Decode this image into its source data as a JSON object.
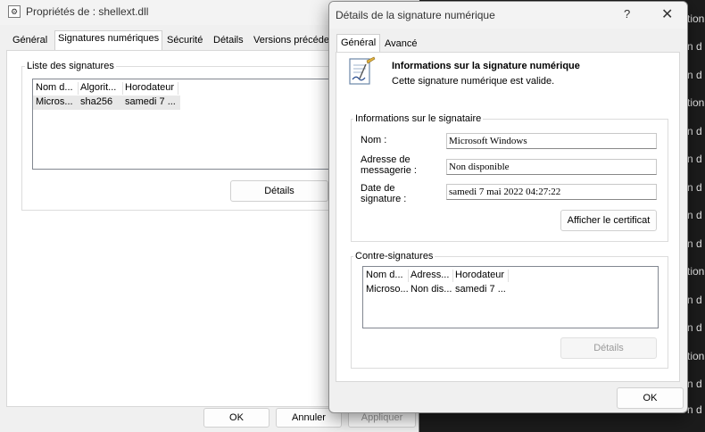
{
  "background_text": [
    "tion",
    "n d",
    "n d",
    "tion",
    "n d",
    "n d",
    "n d",
    "n d",
    "n d",
    "tion",
    "n d",
    "n d",
    "tion",
    "n d",
    "n d"
  ],
  "properties_window": {
    "title": "Propriétés de : shellext.dll",
    "tabs": [
      "Général",
      "Signatures numériques",
      "Sécurité",
      "Détails",
      "Versions précéde"
    ],
    "active_tab": "Signatures numériques",
    "group_label": "Liste des signatures",
    "columns": [
      "Nom d...",
      "Algorit...",
      "Horodateur"
    ],
    "rows": [
      [
        "Micros...",
        "sha256",
        "samedi 7 ..."
      ]
    ],
    "details_label": "Détails",
    "ok_label": "OK",
    "cancel_label": "Annuler",
    "apply_label": "Appliquer"
  },
  "details_dialog": {
    "title": "Détails de la signature numérique",
    "help_label": "?",
    "close_label": "✕",
    "tabs": [
      "Général",
      "Avancé"
    ],
    "active_tab": "Général",
    "heading": "Informations sur la signature numérique",
    "status": "Cette signature numérique est valide.",
    "signer": {
      "group_label": "Informations sur le signataire",
      "name_label": "Nom :",
      "name_value": "Microsoft Windows",
      "email_label_1": "Adresse de",
      "email_label_2": "messagerie :",
      "email_value": "Non disponible",
      "date_label_1": "Date de",
      "date_label_2": "signature :",
      "date_value": "samedi 7 mai 2022 04:27:22",
      "view_cert_label": "Afficher le certificat"
    },
    "countersignatures": {
      "group_label": "Contre-signatures",
      "columns": [
        "Nom d...",
        "Adress...",
        "Horodateur"
      ],
      "rows": [
        [
          "Microso...",
          "Non dis...",
          "samedi 7 ..."
        ]
      ],
      "details_label": "Détails"
    },
    "ok_label": "OK"
  }
}
